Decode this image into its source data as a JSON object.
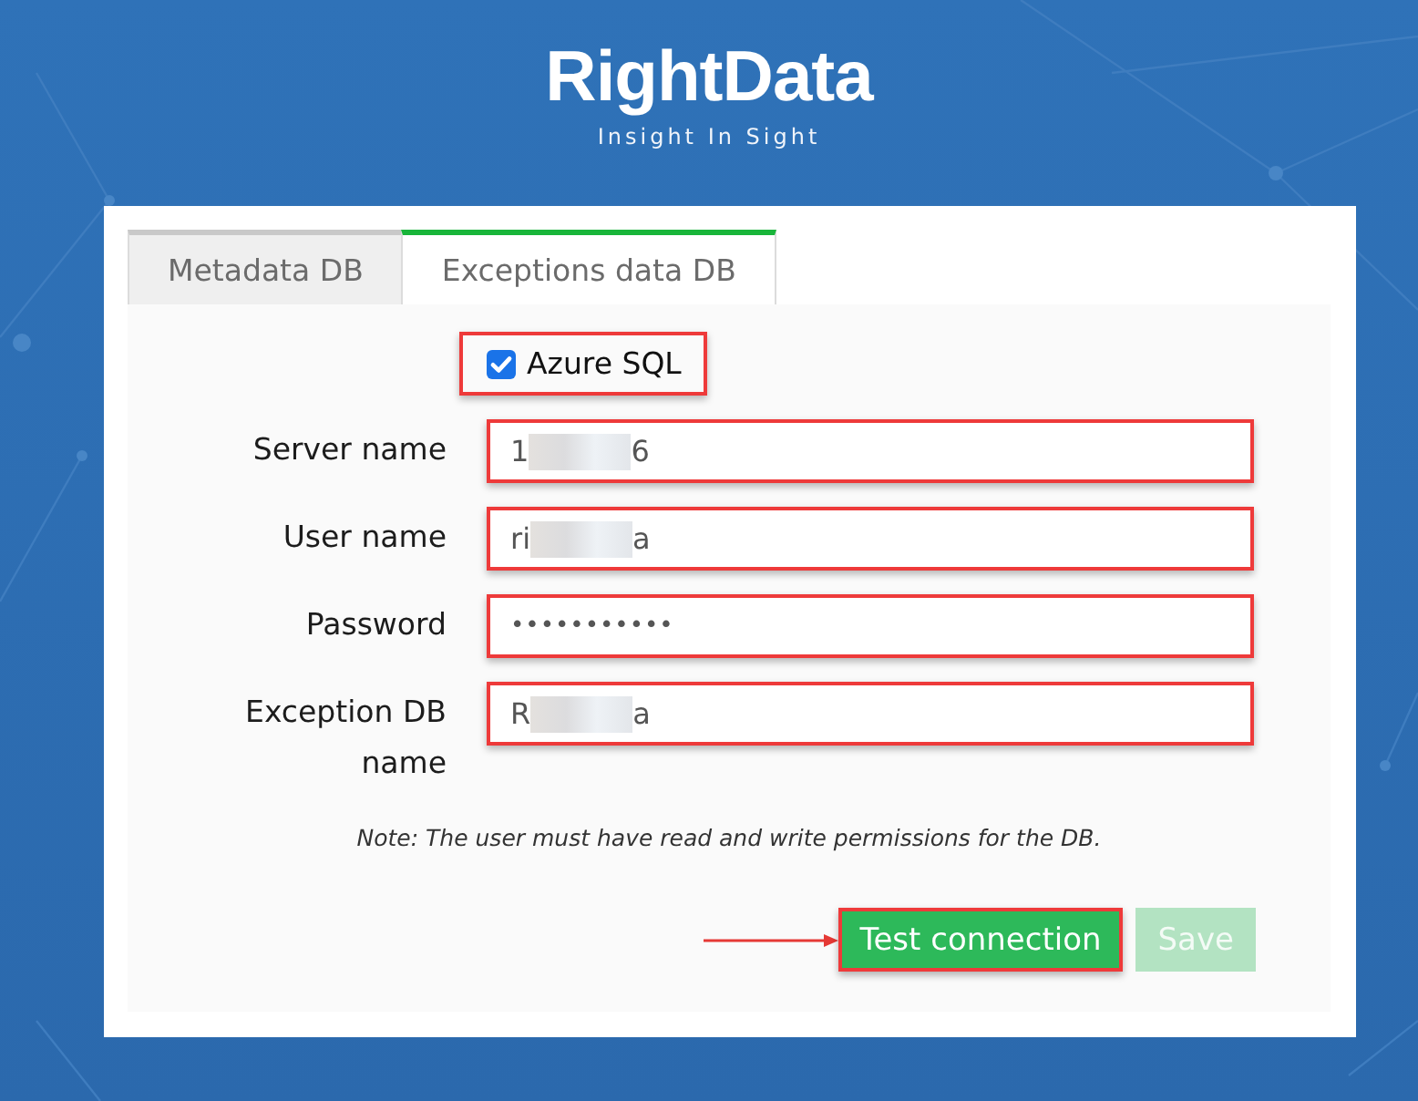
{
  "logo": {
    "name": "RightData",
    "tagline": "Insight In Sight"
  },
  "tabs": [
    {
      "label": "Metadata DB",
      "selected": false
    },
    {
      "label": "Exceptions data DB",
      "selected": true
    }
  ],
  "checkbox": {
    "label": "Azure SQL",
    "checked": true,
    "highlighted": true
  },
  "fields": [
    {
      "label": "Server name",
      "kind": "text",
      "value_start": "1",
      "value_end": "6",
      "redacted": true,
      "highlighted": true
    },
    {
      "label": "User name",
      "kind": "text",
      "value_start": "ri",
      "value_end": "a",
      "redacted": true,
      "highlighted": true
    },
    {
      "label": "Password",
      "kind": "password",
      "value": "•••••••••••",
      "highlighted": true
    },
    {
      "label": "Exception DB name",
      "kind": "text",
      "value_start": "R",
      "value_end": "a",
      "redacted": true,
      "highlighted": true
    }
  ],
  "note": "Note: The user must have read and write permissions for the DB.",
  "buttons": [
    {
      "label": "Test connection",
      "disabled": false,
      "highlighted": true,
      "arrow": true
    },
    {
      "label": "Save",
      "disabled": true,
      "highlighted": false,
      "arrow": false
    }
  ]
}
